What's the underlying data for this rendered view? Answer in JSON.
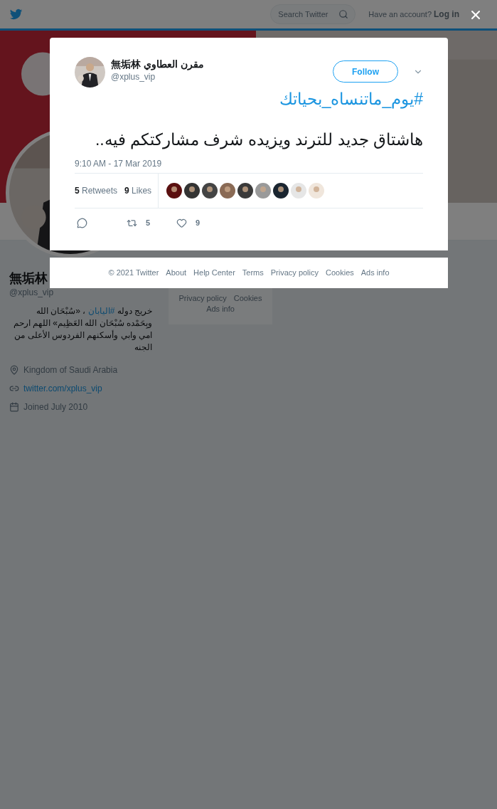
{
  "top_bar": {
    "search": {
      "placeholder": "Search Twitter"
    },
    "account_prompt": "Have an account?",
    "login": "Log in"
  },
  "profile": {
    "name": "無垢林",
    "handle": "@xplus_vip",
    "bio": [
      {
        "kind": "text",
        "text": "خريج دوله "
      },
      {
        "kind": "hashtag",
        "text": "#اليابان"
      },
      {
        "kind": "text",
        "text": " ، «سُبْحَان الله وبِحَمْده سُبْحَان الله العَظِيم» اللهم ارحم امي وابي وأسكنهم الفردوس الأعلى من الجنه"
      }
    ],
    "location": "Kingdom of Saudi Arabia",
    "website": "twitter.com/xplus_vip",
    "joined": "Joined July 2010"
  },
  "side_footer": {
    "links": [
      "Privacy policy",
      "Cookies",
      "Ads info"
    ]
  },
  "modal": {
    "author": {
      "name": "無垢林 مقرن العطاوي",
      "handle": "@xplus_vip"
    },
    "follow": "Follow",
    "hashtag": "#يوم_ماتنساه_بحياتك",
    "text": "هاشتاق جديد للترند ويزيده شرف مشاركتكم فيه..",
    "time": "9:10 AM - 17 Mar 2019",
    "stats": [
      {
        "count": "5",
        "label": "Retweets"
      },
      {
        "count": "9",
        "label": "Likes"
      }
    ],
    "actions": [
      {
        "kind": "reply"
      },
      {
        "kind": "retweet",
        "count": "5"
      },
      {
        "kind": "like",
        "count": "9"
      }
    ]
  },
  "footer": {
    "links": [
      "© 2021 Twitter",
      "About",
      "Help Center",
      "Terms",
      "Privacy policy",
      "Cookies",
      "Ads info"
    ]
  }
}
